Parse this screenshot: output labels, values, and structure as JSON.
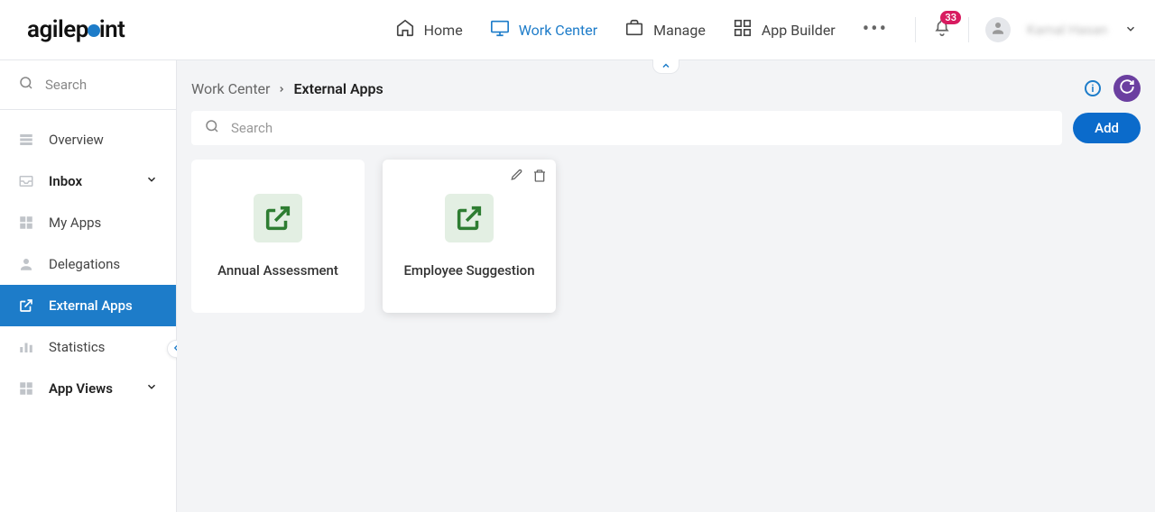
{
  "logo": {
    "prefix": "agilep",
    "suffix": "int"
  },
  "nav": {
    "home": "Home",
    "work_center": "Work Center",
    "manage": "Manage",
    "app_builder": "App Builder"
  },
  "notification_count": "33",
  "user_name": "Kamal Hasan",
  "sidebar": {
    "search_placeholder": "Search",
    "items": {
      "overview": "Overview",
      "inbox": "Inbox",
      "my_apps": "My Apps",
      "delegations": "Delegations",
      "external_apps": "External Apps",
      "statistics": "Statistics",
      "app_views": "App Views"
    }
  },
  "breadcrumb": {
    "parent": "Work Center",
    "current": "External Apps"
  },
  "main_search_placeholder": "Search",
  "add_label": "Add",
  "cards": [
    {
      "label": "Annual Assessment"
    },
    {
      "label": "Employee Suggestion"
    }
  ],
  "info_char": "i"
}
